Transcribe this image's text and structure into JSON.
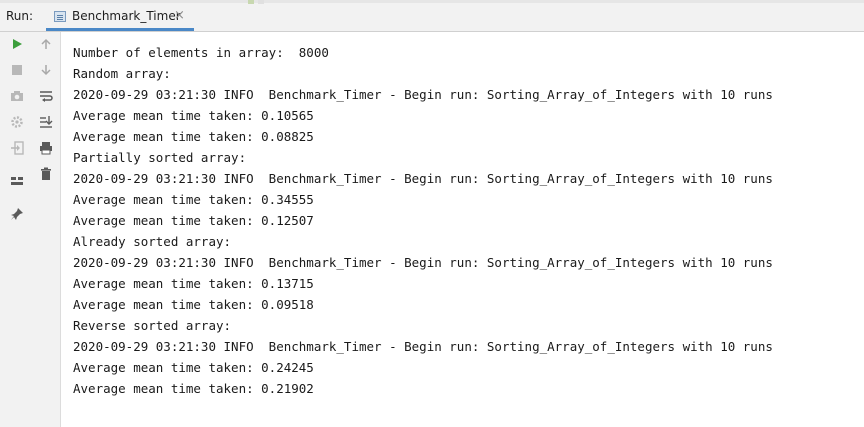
{
  "header": {
    "run_label": "Run:",
    "tab_label": "Benchmark_Timer",
    "tab_close": "×"
  },
  "toolbar": {
    "left": [
      {
        "icon": "play-icon",
        "color": "#3c9e3c"
      },
      {
        "icon": "stop-icon",
        "color": "#b0b0b0"
      },
      {
        "icon": "camera-icon",
        "color": "#b0b0b0"
      },
      {
        "icon": "settings-icon",
        "color": "#b0b0b0"
      },
      {
        "icon": "login-icon",
        "color": "#b0b0b0"
      },
      {
        "icon": "layout-icon",
        "color": "#5a5a5a"
      },
      {
        "icon": "pin-icon",
        "color": "#5a5a5a"
      }
    ],
    "right": [
      {
        "icon": "arrow-up-icon"
      },
      {
        "icon": "arrow-down-icon"
      },
      {
        "icon": "soft-wrap-icon"
      },
      {
        "icon": "scroll-to-end-icon"
      },
      {
        "icon": "print-icon"
      },
      {
        "icon": "trash-icon"
      }
    ]
  },
  "console": {
    "lines": [
      "Number of elements in array:  8000",
      "Random array:",
      "2020-09-29 03:21:30 INFO  Benchmark_Timer - Begin run: Sorting_Array_of_Integers with 10 runs",
      "Average mean time taken: 0.10565",
      "Average mean time taken: 0.08825",
      "Partially sorted array:",
      "2020-09-29 03:21:30 INFO  Benchmark_Timer - Begin run: Sorting_Array_of_Integers with 10 runs",
      "Average mean time taken: 0.34555",
      "Average mean time taken: 0.12507",
      "Already sorted array:",
      "2020-09-29 03:21:30 INFO  Benchmark_Timer - Begin run: Sorting_Array_of_Integers with 10 runs",
      "Average mean time taken: 0.13715",
      "Average mean time taken: 0.09518",
      "Reverse sorted array:",
      "2020-09-29 03:21:30 INFO  Benchmark_Timer - Begin run: Sorting_Array_of_Integers with 10 runs",
      "Average mean time taken: 0.24245",
      "Average mean time taken: 0.21902"
    ]
  }
}
